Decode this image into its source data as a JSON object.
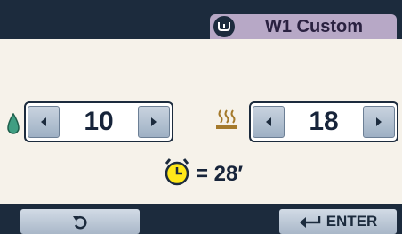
{
  "header": {
    "mode_title": "W1 Custom",
    "mode_icon": "laundry-symbol-icon"
  },
  "main": {
    "water_stepper": {
      "icon": "water-drop-icon",
      "value": "10",
      "decrement_icon": "left-arrow-icon",
      "increment_icon": "right-arrow-icon"
    },
    "temperature_stepper": {
      "icon": "heat-icon",
      "value": "18",
      "decrement_icon": "left-arrow-icon",
      "increment_icon": "right-arrow-icon"
    },
    "timer": {
      "icon": "stopwatch-icon",
      "value": "= 28′"
    }
  },
  "footer": {
    "back_icon": "rotate-back-icon",
    "enter_label": "ENTER",
    "enter_icon": "return-arrow-icon"
  },
  "colors": {
    "background": "#f6f2ea",
    "dark_bar": "#1c2b3d",
    "mode_tab": "#b7a8c6",
    "drop": "#3f9e82",
    "heat": "#a57a2c",
    "timer_face": "#ffe81a"
  }
}
